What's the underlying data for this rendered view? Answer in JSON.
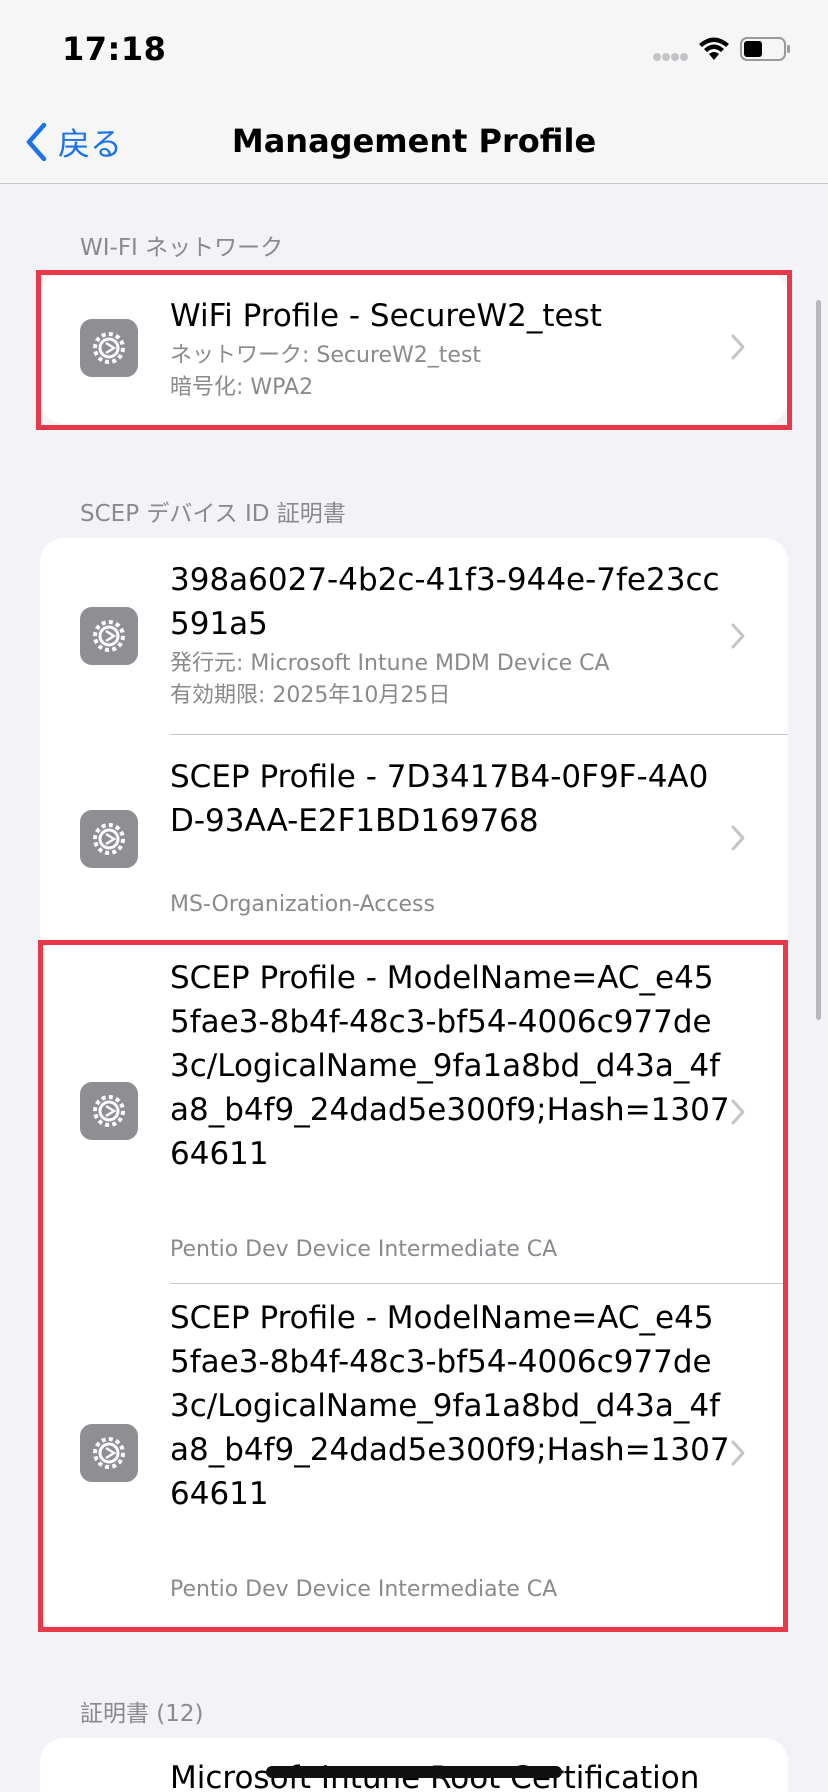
{
  "status_bar": {
    "time": "17:18"
  },
  "nav": {
    "back_label": "戻る",
    "title": "Management Profile"
  },
  "sections": {
    "wifi": {
      "header": "WI-FI ネットワーク",
      "rows": [
        {
          "title": "WiFi Profile - SecureW2_test",
          "sub1": "ネットワーク: SecureW2_test",
          "sub2": "暗号化: WPA2"
        }
      ]
    },
    "scep": {
      "header": "SCEP デバイス ID 証明書",
      "rows": [
        {
          "title": "398a6027-4b2c-41f3-944e-7fe23cc591a5",
          "sub1": "発行元: Microsoft Intune MDM Device CA",
          "sub2": "有効期限: 2025年10月25日"
        },
        {
          "title": "SCEP Profile - 7D3417B4-0F9F-4A0D-93AA-E2F1BD169768",
          "sub1": "MS-Organization-Access"
        },
        {
          "title": "SCEP Profile - ModelName=AC_e455fae3-8b4f-48c3-bf54-4006c977de3c/LogicalName_9fa1a8bd_d43a_4fa8_b4f9_24dad5e300f9;Hash=130764611",
          "sub1": "Pentio Dev Device Intermediate CA"
        },
        {
          "title": "SCEP Profile - ModelName=AC_e455fae3-8b4f-48c3-bf54-4006c977de3c/LogicalName_9fa1a8bd_d43a_4fa8_b4f9_24dad5e300f9;Hash=130764611",
          "sub1": "Pentio Dev Device Intermediate CA"
        }
      ]
    },
    "certs": {
      "header": "証明書 (12)",
      "rows": [
        {
          "title": "Microsoft Intune Root Certification"
        }
      ]
    }
  },
  "colors": {
    "accent": "#1a73e8",
    "highlight": "#e8394b",
    "icon_bg": "#8e8e93"
  },
  "icons": {
    "row_icon": "gear-icon",
    "back": "chevron-left-icon",
    "disclosure": "chevron-right-icon"
  }
}
